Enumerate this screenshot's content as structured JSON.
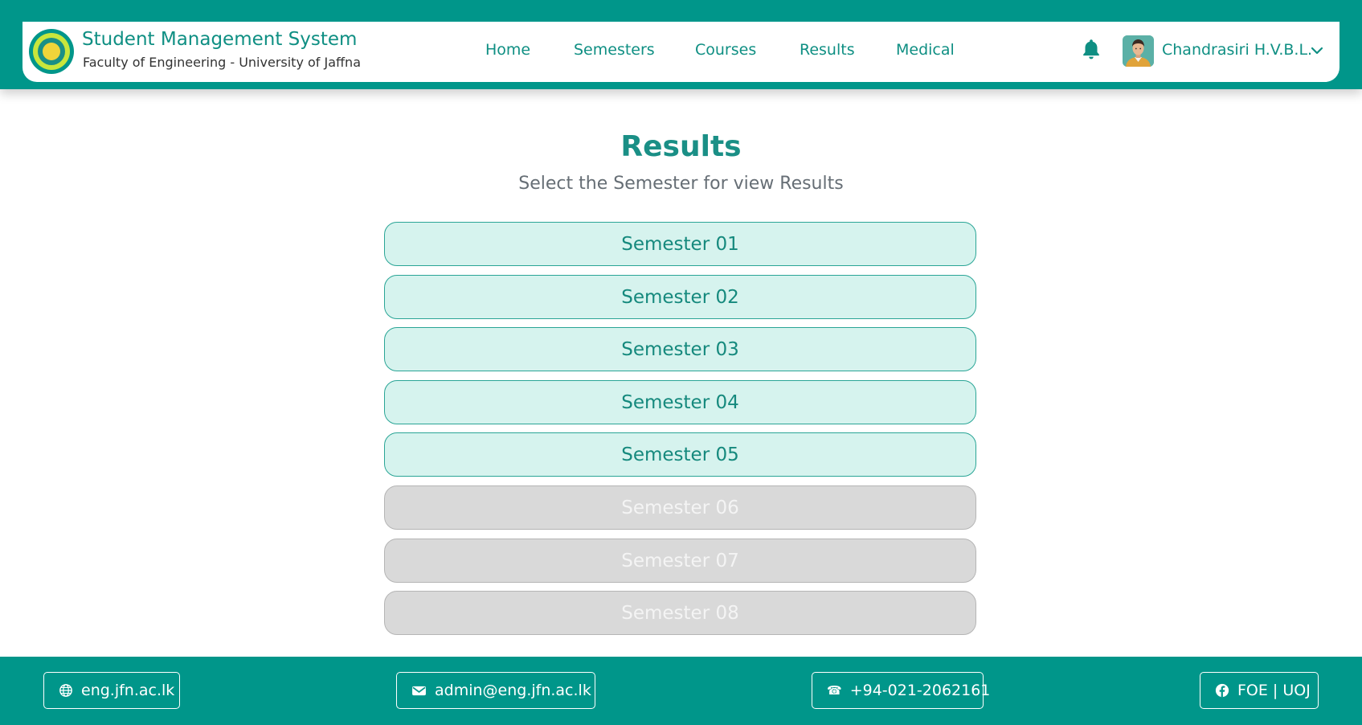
{
  "header": {
    "brand_title": "Student Management System",
    "brand_subtitle": "Faculty of Engineering - University of Jaffna",
    "nav": [
      "Home",
      "Semesters",
      "Courses",
      "Results",
      "Medical"
    ],
    "user_name": "Chandrasiri H.V.B.L.",
    "icons": [
      "university-logo",
      "bell-icon",
      "avatar",
      "chevron-down-icon"
    ]
  },
  "main": {
    "title": "Results",
    "subtitle": "Select the Semester for view Results",
    "semesters": [
      {
        "label": "Semester 01",
        "state": "active"
      },
      {
        "label": "Semester 02",
        "state": "active"
      },
      {
        "label": "Semester 03",
        "state": "active"
      },
      {
        "label": "Semester 04",
        "state": "active"
      },
      {
        "label": "Semester 05",
        "state": "active"
      },
      {
        "label": "Semester 06",
        "state": "disabled"
      },
      {
        "label": "Semester 07",
        "state": "disabled"
      },
      {
        "label": "Semester 08",
        "state": "disabled"
      }
    ]
  },
  "footer": {
    "website": "eng.jfn.ac.lk",
    "email": "admin@eng.jfn.ac.lk",
    "phone": "+94-021-2062161",
    "facebook": "FOE | UOJ",
    "icons": [
      "globe-icon",
      "mail-icon",
      "phone-icon",
      "facebook-icon"
    ]
  },
  "colors": {
    "primary": "#00968a",
    "active_bg": "#d6f3ee",
    "disabled_bg": "#d9d9d9"
  }
}
